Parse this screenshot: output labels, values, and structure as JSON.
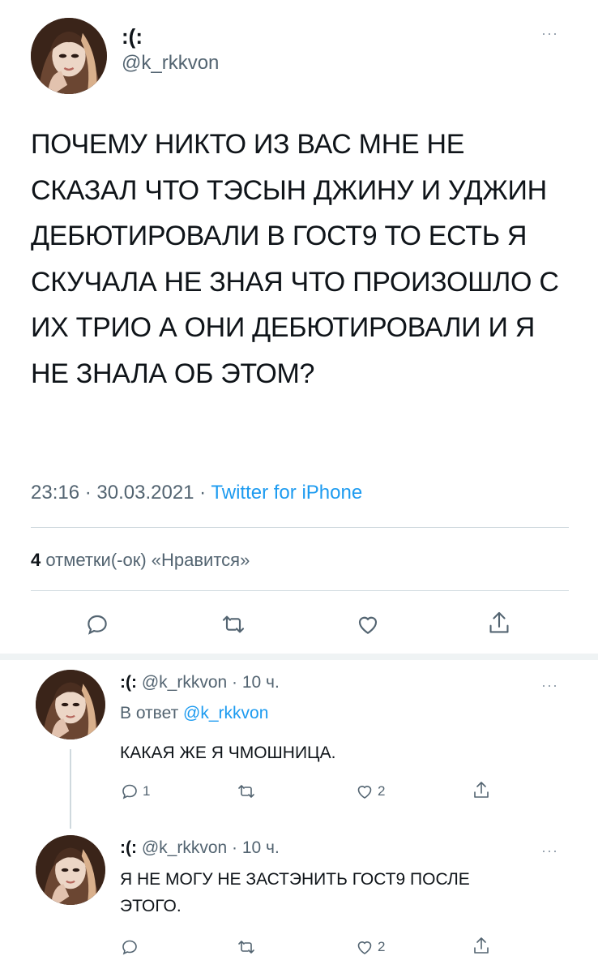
{
  "main_tweet": {
    "display_name": ":(:",
    "handle": "@k_rkkvon",
    "text": "ПОЧЕМУ НИКТО ИЗ ВАС МНЕ НЕ СКАЗАЛ ЧТО ТЭСЫН ДЖИНУ И УДЖИН ДЕБЮТИРОВАЛИ В ГОСТ9 ТО ЕСТЬ Я СКУЧАЛА НЕ ЗНАЯ ЧТО ПРОИЗОШЛО С ИХ ТРИО А ОНИ ДЕБЮТИРОВАЛИ И Я НЕ ЗНАЛА ОБ ЭТОМ?",
    "time": "23:16",
    "date": "30.03.2021",
    "separator": " · ",
    "source": "Twitter for iPhone",
    "likes_count": "4",
    "likes_label": "отметки(-ок) «Нравится»",
    "actions": [
      "reply-icon",
      "retweet-icon",
      "like-icon",
      "share-icon"
    ]
  },
  "replies": [
    {
      "display_name": ":(:",
      "handle": "@k_rkkvon",
      "age": "· 10 ч.",
      "reply_prefix": "В ответ",
      "reply_to": "@k_rkkvon",
      "text": "КАКАЯ ЖЕ Я ЧМОШНИЦА.",
      "reply_count": "1",
      "retweet_count": "",
      "like_count": "2"
    },
    {
      "display_name": ":(:",
      "handle": "@k_rkkvon",
      "age": "· 10 ч.",
      "text": "Я НЕ МОГУ НЕ ЗАСТЭНИТЬ ГОСТ9 ПОСЛЕ ЭТОГО.",
      "reply_count": "",
      "retweet_count": "",
      "like_count": "2"
    }
  ],
  "more_glyph": "···",
  "colors": {
    "accent": "#1d9bf0",
    "muted": "#536471",
    "divider": "#cfd9de"
  }
}
